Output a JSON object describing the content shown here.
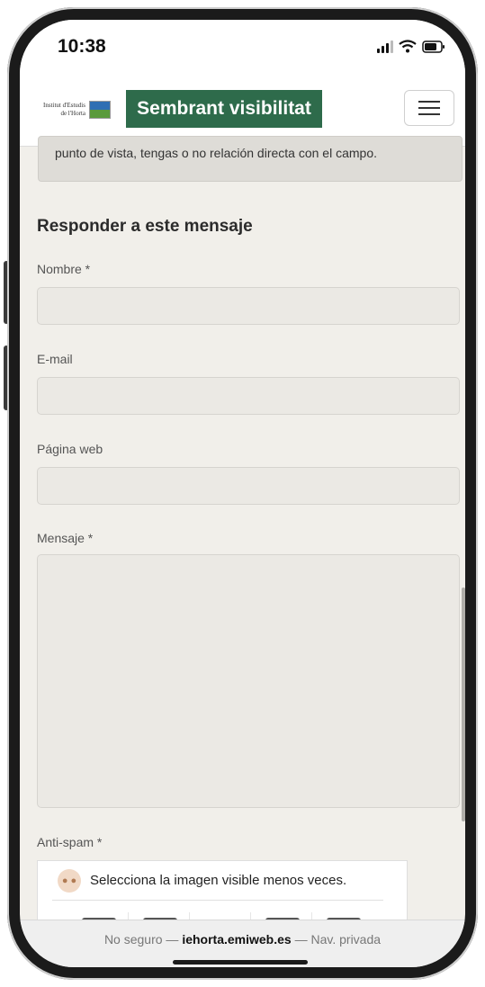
{
  "status": {
    "time": "10:38"
  },
  "header": {
    "logo_line1": "Institut d'Estudis",
    "logo_line2": "de l'Horta",
    "brand": "Sembrant visibilitat",
    "menu_icon": "hamburger-menu-icon"
  },
  "quote": {
    "text": "punto de vista, tengas o no relación directa con el campo."
  },
  "form": {
    "heading": "Responder a este mensaje",
    "name_label": "Nombre *",
    "email_label": "E-mail",
    "web_label": "Página web",
    "message_label": "Mensaje *",
    "antispam_label": "Anti-spam *",
    "captcha_prompt": "Selecciona la imagen visible menos veces."
  },
  "url_bar": {
    "prefix": "No seguro —",
    "domain": "iehorta.emiweb.es",
    "suffix": "— Nav. privada"
  },
  "colors": {
    "brand": "#2e6b4b",
    "page_bg": "#f1efea"
  }
}
